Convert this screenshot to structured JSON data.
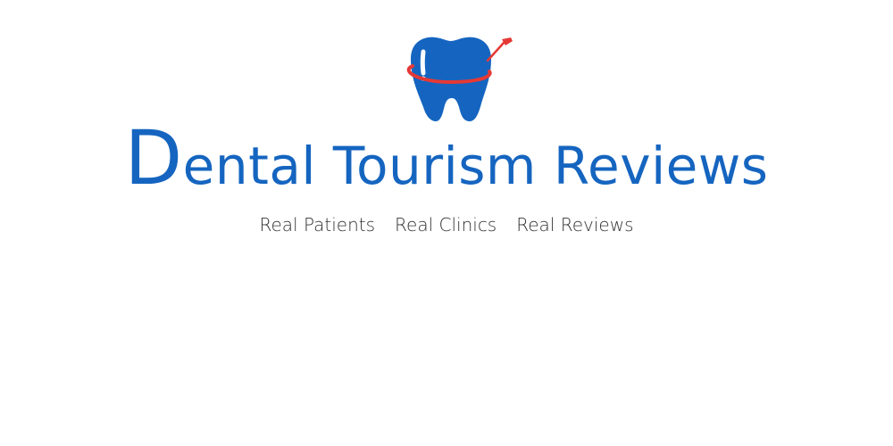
{
  "logo": {
    "icon": "tooth-orbit-icon",
    "tooth_color": "#1565c0",
    "orbit_color": "#e53935"
  },
  "brand": {
    "initial": "D",
    "rest": "ental Tourism Reviews",
    "color": "#1565c0"
  },
  "tagline": {
    "items": [
      "Real Patients",
      "Real Clinics",
      "Real Reviews"
    ],
    "color": "#333333"
  }
}
